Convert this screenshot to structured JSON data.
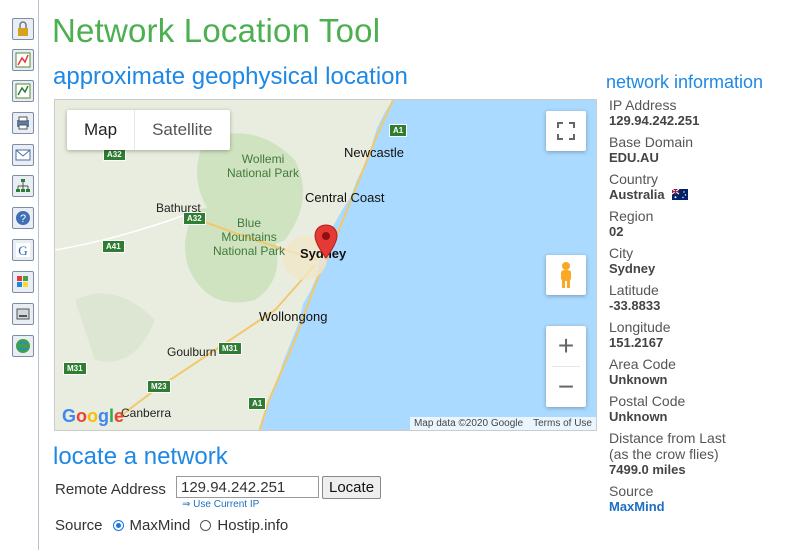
{
  "app_title": "Network Location Tool",
  "sections": {
    "geo": "approximate geophysical location",
    "locate": "locate a network",
    "info": "network information"
  },
  "rail_icons": [
    "lock-icon",
    "chart-icon",
    "chart2-icon",
    "print-icon",
    "mail-icon",
    "tree-icon",
    "help-icon",
    "google-icon",
    "windows-icon",
    "drive-icon",
    "globe-icon"
  ],
  "map": {
    "map_type": {
      "map": "Map",
      "satellite": "Satellite"
    },
    "zoom_in": "+",
    "zoom_out": "−",
    "attribution": "Map data ©2020 Google",
    "terms": "Terms of Use",
    "logo": "Google",
    "labels": {
      "newcastle": "Newcastle",
      "central_coast": "Central Coast",
      "sydney": "Sydney",
      "wollongong": "Wollongong",
      "goulburn": "Goulburn",
      "canberra": "Canberra",
      "bathurst": "Bathurst",
      "wollemi": "Wollemi\nNational Park",
      "blue_mountains": "Blue\nMountains\nNational Park"
    },
    "roads": {
      "a1_top": "A1",
      "a32_top": "A32",
      "a32": "A32",
      "a41": "A41",
      "m31": "M31",
      "m31b": "M31",
      "m23": "M23",
      "a1_bottom": "A1"
    }
  },
  "locate": {
    "label": "Remote Address",
    "value": "129.94.242.251",
    "button": "Locate",
    "use_current": "Use Current IP",
    "source_label": "Source",
    "options": [
      "MaxMind",
      "Hostip.info"
    ],
    "selected": "MaxMind"
  },
  "info": {
    "ip_label": "IP Address",
    "ip": "129.94.242.251",
    "domain_label": "Base Domain",
    "domain": "EDU.AU",
    "country_label": "Country",
    "country": "Australia",
    "region_label": "Region",
    "region": "02",
    "city_label": "City",
    "city": "Sydney",
    "lat_label": "Latitude",
    "lat": "-33.8833",
    "lon_label": "Longitude",
    "lon": "151.2167",
    "area_label": "Area Code",
    "area": "Unknown",
    "postal_label": "Postal Code",
    "postal": "Unknown",
    "distance_label": "Distance from Last",
    "distance_note": "(as the crow flies)",
    "distance": "7499.0 miles",
    "source_label": "Source",
    "source": "MaxMind"
  },
  "colors": {
    "title": "#4caf50",
    "section": "#1e88e5",
    "link": "#1e6fc4",
    "marker": "#e53935",
    "water": "#aadaff"
  }
}
